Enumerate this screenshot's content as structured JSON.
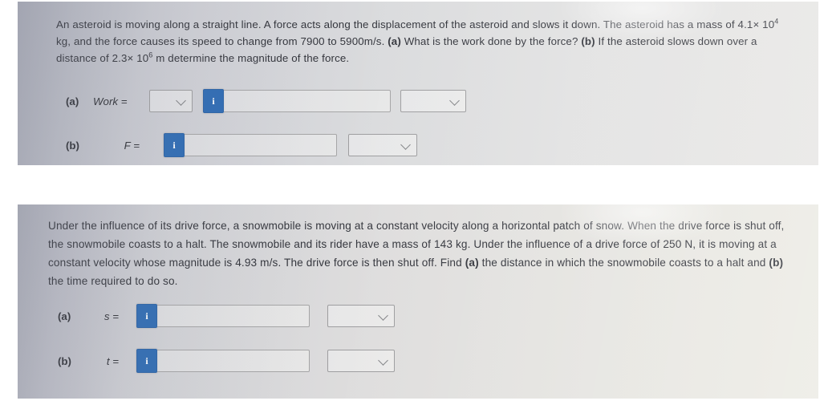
{
  "document": {
    "background_color": "#ffffff",
    "accent_color": "#2f6cb4"
  },
  "problems": [
    {
      "id": "asteroid",
      "panel_background": "#d5d6da",
      "statement_html": "An asteroid is moving along a straight line. A force acts along the displacement of the asteroid and slows it down. The asteroid has a mass of 4.1× 10<sup>4</sup> kg, and the force causes its speed to change from 7900 to 5900m/s. <b>(a)</b> What is the work done by the force? <b>(b)</b> If the asteroid slows down over a distance of 2.3× 10<sup>6</sup> m determine the magnitude of the force.",
      "answers": [
        {
          "part": "(a)",
          "variable": "Work =",
          "controls": [
            "prefix-select",
            "info-badge",
            "text-input",
            "unit-select"
          ],
          "prefix_select_value": "",
          "input_value": "",
          "unit_select_value": "",
          "info_badge_label": "i"
        },
        {
          "part": "(b)",
          "variable": "F =",
          "controls": [
            "info-badge",
            "text-input",
            "unit-select"
          ],
          "input_value": "",
          "unit_select_value": "",
          "info_badge_label": "i"
        }
      ]
    },
    {
      "id": "snowmobile",
      "panel_background": "#d9dadc",
      "statement_html": "Under the influence of its drive force, a snowmobile is moving at a constant velocity along a horizontal patch of snow. When the drive force is shut off, the snowmobile coasts to a halt. The snowmobile and its rider have a mass of 143 kg. Under the influence of a drive force of 250 N, it is moving at a constant velocity whose magnitude is 4.93 m/s. The drive force is then shut off. Find <b>(a)</b> the distance in which the snowmobile coasts to a halt and <b>(b)</b> the time required to do so.",
      "answers": [
        {
          "part": "(a)",
          "variable": "s =",
          "controls": [
            "info-badge",
            "text-input",
            "unit-select"
          ],
          "input_value": "",
          "unit_select_value": "",
          "info_badge_label": "i"
        },
        {
          "part": "(b)",
          "variable": "t =",
          "controls": [
            "info-badge",
            "text-input",
            "unit-select"
          ],
          "input_value": "",
          "unit_select_value": "",
          "info_badge_label": "i"
        }
      ]
    }
  ]
}
